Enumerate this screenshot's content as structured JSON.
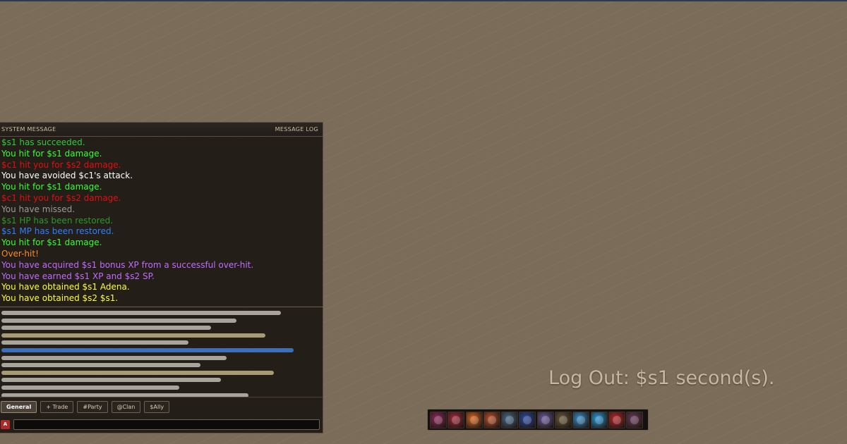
{
  "chat": {
    "header_left": "SYSTEM MESSAGE",
    "header_right": "MESSAGE LOG",
    "messages": [
      {
        "text": "$s1 has succeeded.",
        "color": "#2fcb3a"
      },
      {
        "text": "You hit for $s1 damage.",
        "color": "#39ff33"
      },
      {
        "text": "$c1 hit you for $s2 damage.",
        "color": "#e11010"
      },
      {
        "text": "You have avoided $c1's attack.",
        "color": "#ffffff"
      },
      {
        "text": "You hit for $s1 damage.",
        "color": "#39ff33"
      },
      {
        "text": "$c1 hit you for $s2 damage.",
        "color": "#e11010"
      },
      {
        "text": "You have missed.",
        "color": "#9a9a9a"
      },
      {
        "text": "$s1 HP has been restored.",
        "color": "#2a9a2a"
      },
      {
        "text": "$s1 MP has been restored.",
        "color": "#2f7fff"
      },
      {
        "text": "You hit for $s1 damage.",
        "color": "#39ff33"
      },
      {
        "text": "Over-hit!",
        "color": "#ff8a1a"
      },
      {
        "text": "You have acquired $s1 bonus XP from a successful over-hit.",
        "color": "#c36bff"
      },
      {
        "text": "You have earned $s1 XP and $s2 SP.",
        "color": "#c36bff"
      },
      {
        "text": "You have obtained $s1 Adena.",
        "color": "#ffff33"
      },
      {
        "text": "You have obtained $s2 $s1.",
        "color": "#ffff33"
      }
    ],
    "placeholder_lines": [
      {
        "fraction": 0.9,
        "color": "#a9a49b"
      },
      {
        "fraction": 0.756,
        "color": "#a9a49b"
      },
      {
        "fraction": 0.674,
        "color": "#a9a49b"
      },
      {
        "fraction": 0.849,
        "color": "#a89a72"
      },
      {
        "fraction": 0.602,
        "color": "#a9a49b"
      },
      {
        "fraction": 0.94,
        "color": "#3d6fb8"
      },
      {
        "fraction": 0.726,
        "color": "#a9a49b"
      },
      {
        "fraction": 0.642,
        "color": "#a9a49b"
      },
      {
        "fraction": 0.878,
        "color": "#a89a72"
      },
      {
        "fraction": 0.706,
        "color": "#a9a49b"
      },
      {
        "fraction": 0.572,
        "color": "#a9a49b"
      },
      {
        "fraction": 0.796,
        "color": "#a9a49b"
      }
    ],
    "tabs": [
      {
        "label": "General",
        "active": true
      },
      {
        "label": "+ Trade",
        "active": false
      },
      {
        "label": "#Party",
        "active": false
      },
      {
        "label": "@Clan",
        "active": false
      },
      {
        "label": "$Ally",
        "active": false
      }
    ],
    "channel_icon": "A",
    "input_value": "",
    "input_placeholder": ""
  },
  "logout_text": "Log Out: $s1 second(s).",
  "skillbar": {
    "slots": [
      {
        "icon": "warrior-portrait-icon",
        "color": "#8a2a5a"
      },
      {
        "icon": "crimson-strike-icon",
        "color": "#a0283c"
      },
      {
        "icon": "fire-burst-icon",
        "color": "#d8641e"
      },
      {
        "icon": "flame-fist-icon",
        "color": "#b8502a"
      },
      {
        "icon": "cyclone-icon",
        "color": "#4a6a8a"
      },
      {
        "icon": "blue-lightning-icon",
        "color": "#2a4aa0"
      },
      {
        "icon": "mystic-figure-icon",
        "color": "#6a5a9a"
      },
      {
        "icon": "beast-claw-icon",
        "color": "#6a5a3a"
      },
      {
        "icon": "ice-shard-icon",
        "color": "#3a8ac8"
      },
      {
        "icon": "frost-wave-icon",
        "color": "#2a9ad8"
      },
      {
        "icon": "blood-rage-icon",
        "color": "#b8282a"
      },
      {
        "icon": "dark-wing-icon",
        "color": "#6a3a5a"
      }
    ]
  }
}
